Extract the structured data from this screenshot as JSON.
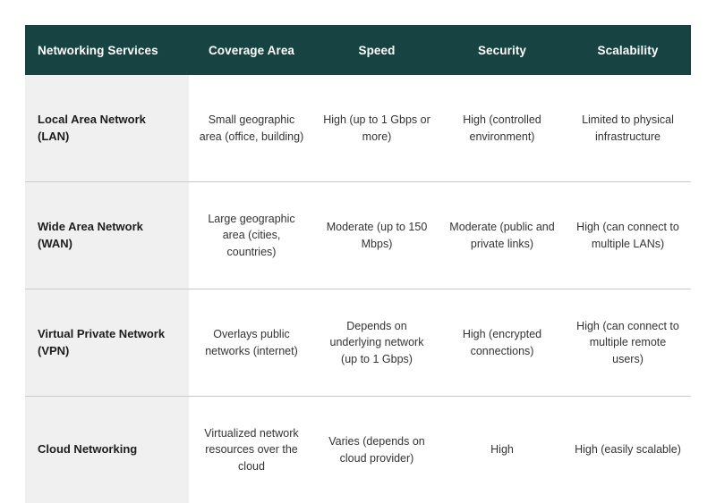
{
  "table": {
    "columns": [
      {
        "key": "service",
        "label": "Networking Services",
        "align": "left"
      },
      {
        "key": "coverage",
        "label": "Coverage Area",
        "align": "center"
      },
      {
        "key": "speed",
        "label": "Speed",
        "align": "center"
      },
      {
        "key": "security",
        "label": "Security",
        "align": "center"
      },
      {
        "key": "scalability",
        "label": "Scalability",
        "align": "center"
      }
    ],
    "rows": [
      {
        "service": "Local Area Network (LAN)",
        "coverage": "Small geographic area (office, building)",
        "speed": "High (up to 1 Gbps or more)",
        "security": "High (controlled environment)",
        "scalability": "Limited to physical infrastructure"
      },
      {
        "service": "Wide Area Network (WAN)",
        "coverage": "Large geographic area (cities, countries)",
        "speed": "Moderate (up to 150 Mbps)",
        "security": "Moderate (public and private links)",
        "scalability": "High (can connect to multiple LANs)"
      },
      {
        "service": "Virtual Private Network (VPN)",
        "coverage": "Overlays public networks (internet)",
        "speed": "Depends on underlying network (up to 1 Gbps)",
        "security": "High (encrypted connections)",
        "scalability": "High (can connect to multiple remote users)"
      },
      {
        "service": "Cloud Networking",
        "coverage": "Virtualized network resources over the cloud",
        "speed": "Varies (depends on cloud provider)",
        "security": "High",
        "scalability": "High (easily scalable)"
      }
    ]
  },
  "colors": {
    "header_background": "#174442",
    "header_text": "#ffffff",
    "first_column_background": "#f1f0f0",
    "row_divider": "#c9c9c9",
    "body_text": "#333333",
    "page_background": "#ffffff"
  }
}
